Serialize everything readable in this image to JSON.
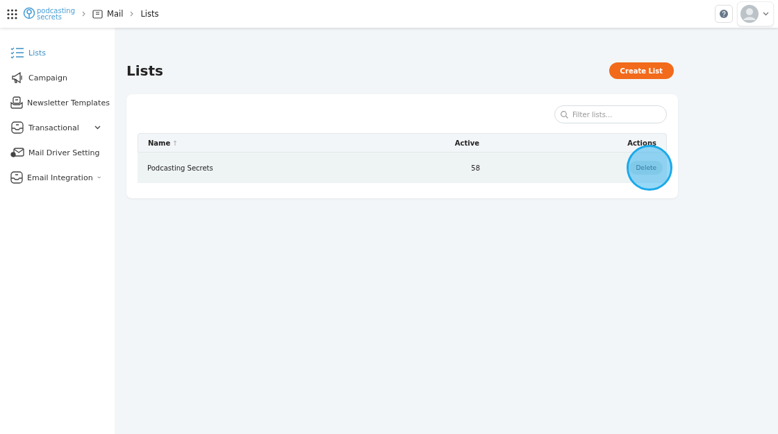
{
  "topbar": {
    "logo": [
      "podcasting",
      "secrets"
    ],
    "breadcrumb": [
      {
        "label": "Mail"
      },
      {
        "label": "Lists"
      }
    ]
  },
  "sidebar": {
    "items": [
      {
        "label": "Lists",
        "selected": true,
        "collapsible": false
      },
      {
        "label": "Campaign",
        "selected": false,
        "collapsible": false
      },
      {
        "label": "Newsletter Templates",
        "selected": false,
        "collapsible": false
      },
      {
        "label": "Transactional",
        "selected": false,
        "collapsible": true
      },
      {
        "label": "Mail Driver Setting",
        "selected": false,
        "collapsible": false
      },
      {
        "label": "Email Integration",
        "selected": false,
        "collapsible": true
      }
    ]
  },
  "page": {
    "title": "Lists",
    "create_button": "Create List",
    "filter": {
      "placeholder": "Filter lists..."
    },
    "table": {
      "columns": [
        {
          "label": "Name",
          "sorted": true
        },
        {
          "label": "Active",
          "sorted": false
        },
        {
          "label": "Actions",
          "sorted": false
        }
      ],
      "rows": [
        {
          "name": "Podcasting Secrets",
          "active": "58",
          "action": "Delete",
          "highlighted": true
        }
      ]
    }
  }
}
